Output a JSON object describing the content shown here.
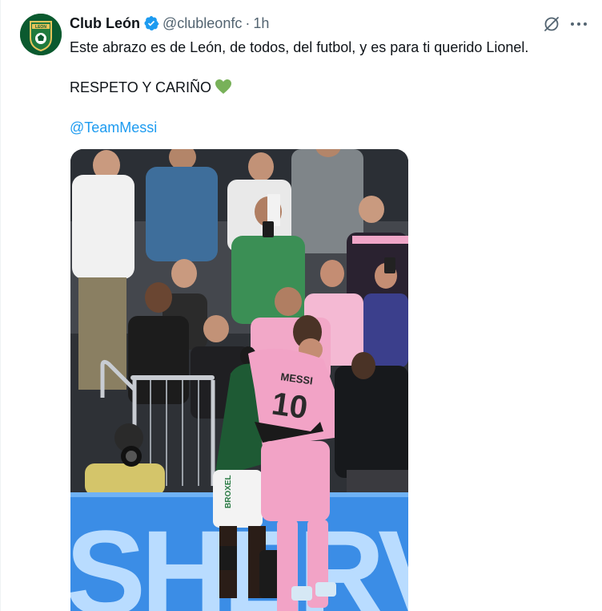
{
  "author": {
    "display_name": "Club León",
    "handle": "@clubleonfc",
    "separator": "·",
    "time": "1h",
    "avatar_icon": "club-leon-crest-icon",
    "verified_icon": "verified-badge-icon",
    "verified_color": "#1d9bf0"
  },
  "tweet": {
    "line1": "Este abrazo es de León, de todos, del futbol, y es para ti querido Lionel.",
    "line2": "RESPETO Y CARIÑO",
    "line2_emoji": "green-heart-icon",
    "mention": "@TeamMessi"
  },
  "actions": {
    "grok_icon": "grok-icon",
    "more_icon": "more-options-icon"
  },
  "media": {
    "jersey_name": "MESSI",
    "jersey_number": "10",
    "banner_text": "SHERV",
    "opponent_sponsor": "BROXEL"
  },
  "colors": {
    "text_primary": "#0f1419",
    "text_secondary": "#536471",
    "link": "#1d9bf0",
    "heart": "#78b159",
    "leon_green": "#0b5a2f",
    "miami_pink": "#f5a3c7"
  }
}
